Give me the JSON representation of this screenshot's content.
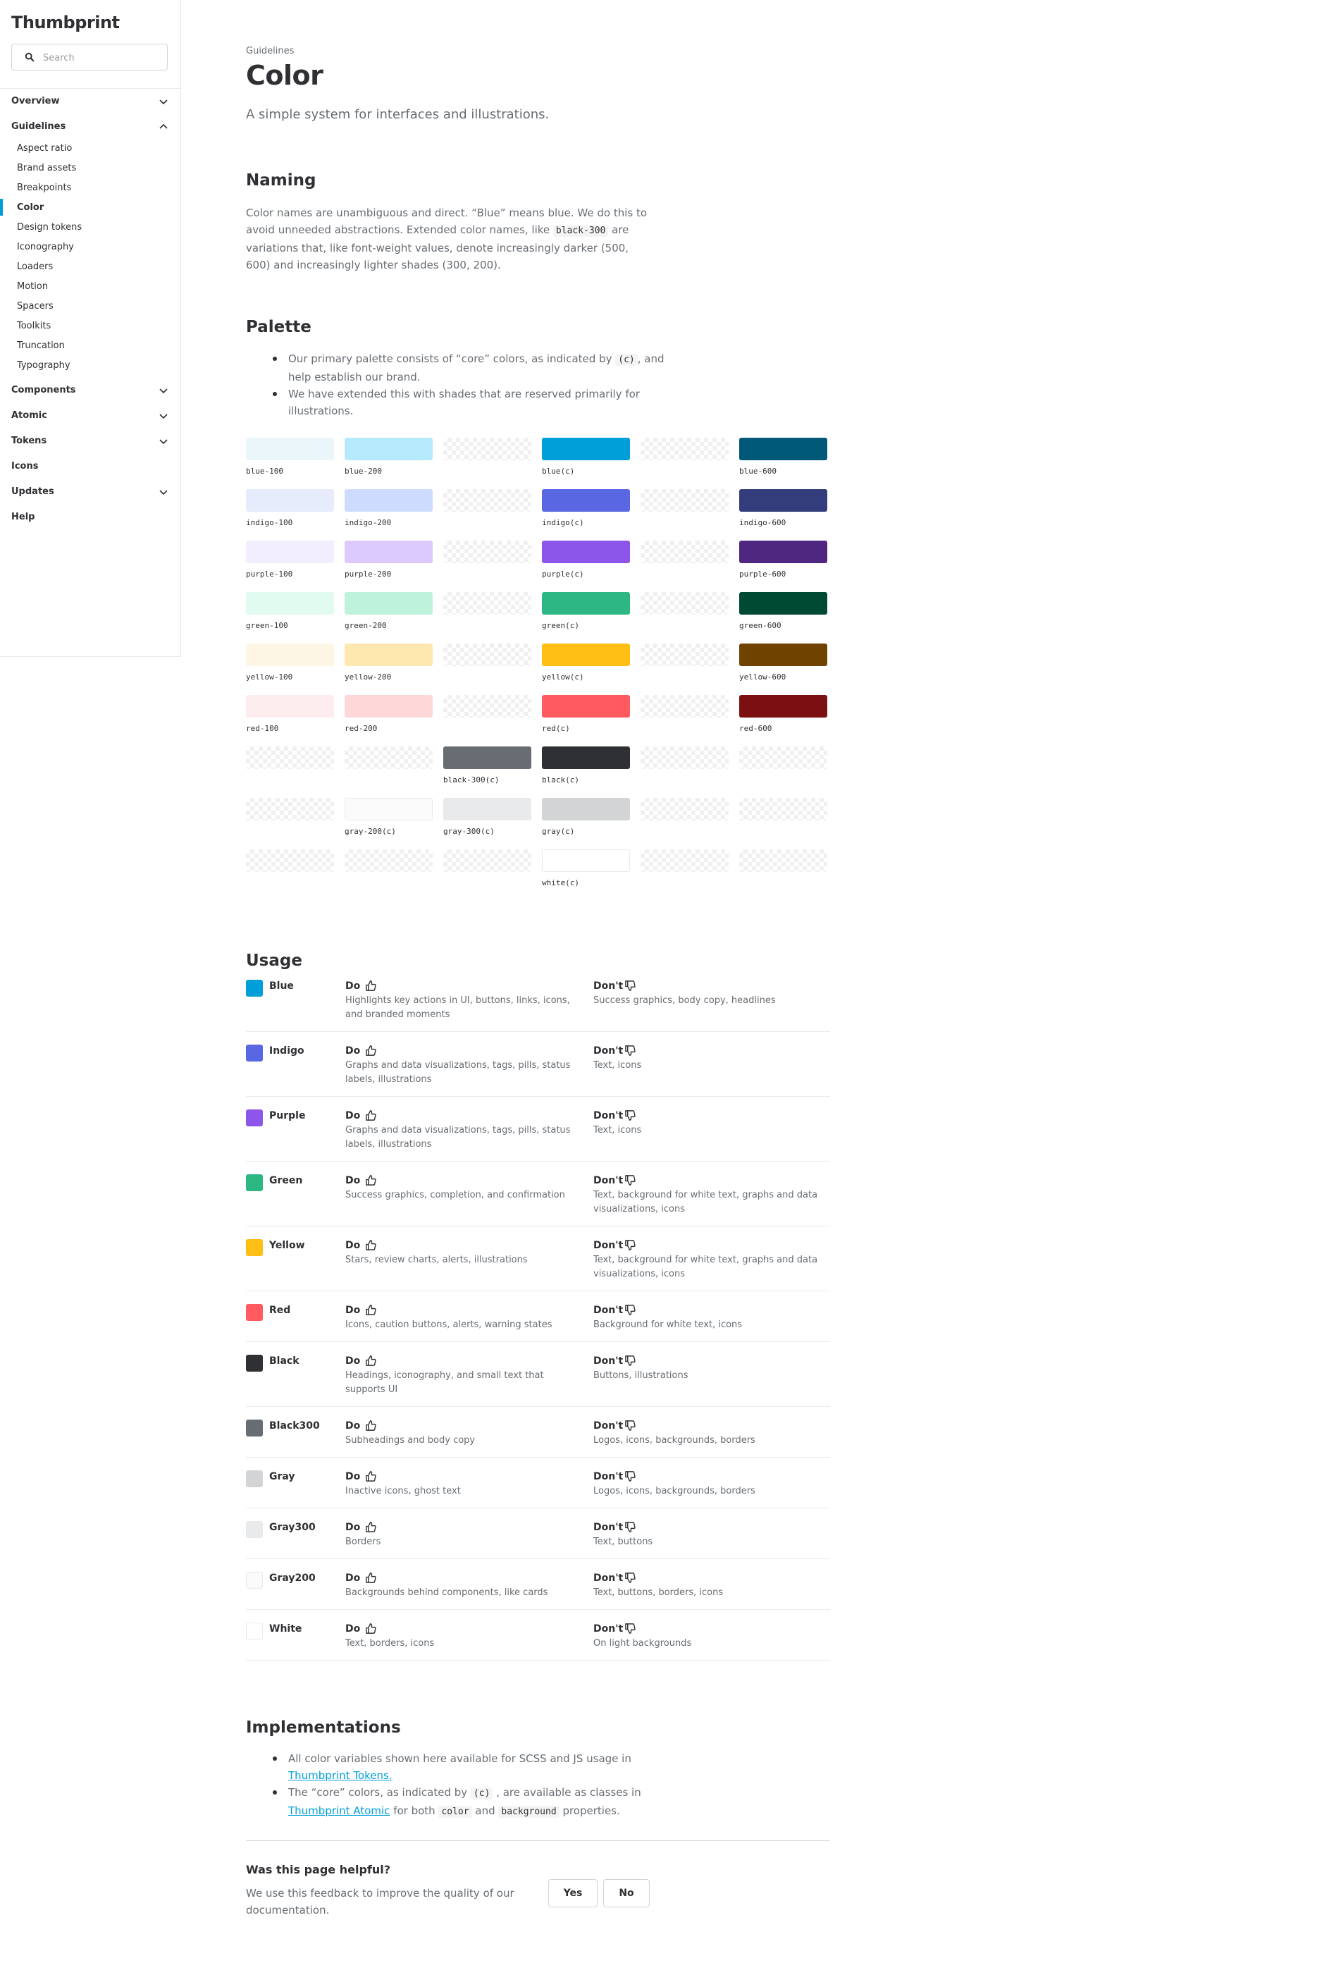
{
  "sidebar": {
    "logo": "Thumbprint",
    "search_placeholder": "Search",
    "sections": [
      {
        "label": "Overview",
        "expanded": false
      },
      {
        "label": "Guidelines",
        "expanded": true
      },
      {
        "label": "Components",
        "expanded": false
      },
      {
        "label": "Atomic",
        "expanded": false
      },
      {
        "label": "Tokens",
        "expanded": false
      },
      {
        "label": "Icons"
      },
      {
        "label": "Updates",
        "expanded": false
      },
      {
        "label": "Help"
      }
    ],
    "guideline_items": [
      "Aspect ratio",
      "Brand assets",
      "Breakpoints",
      "Color",
      "Design tokens",
      "Iconography",
      "Loaders",
      "Motion",
      "Spacers",
      "Toolkits",
      "Truncation",
      "Typography"
    ],
    "active_item": "Color"
  },
  "header": {
    "breadcrumb": "Guidelines",
    "title": "Color",
    "subtitle": "A simple system for interfaces and illustrations."
  },
  "naming": {
    "heading": "Naming",
    "text_1": "Color names are unambiguous and direct. “Blue” means blue. We do this to avoid unneeded abstractions. Extended color names, like",
    "code": "black-300",
    "text_2": "are variations that, like font-weight values, denote increasingly darker (500, 600) and increasingly lighter shades (300, 200)."
  },
  "palette": {
    "heading": "Palette",
    "bullet_1_a": "Our primary palette consists of “core” colors, as indicated by",
    "bullet_1_code": "(c)",
    "bullet_1_b": ", and help establish our brand.",
    "bullet_2": "We have extended this with shades that are reserved primarily for illustrations.",
    "rows": [
      [
        {
          "name": "blue-100",
          "color": "#eaf6fa"
        },
        {
          "name": "blue-200",
          "color": "#b5eafc"
        },
        null,
        {
          "name": "blue(c)",
          "color": "#009fd9"
        },
        null,
        {
          "name": "blue-600",
          "color": "#005879"
        }
      ],
      [
        {
          "name": "indigo-100",
          "color": "#e6ecfb"
        },
        {
          "name": "indigo-200",
          "color": "#cddcfe"
        },
        null,
        {
          "name": "indigo(c)",
          "color": "#5968e2"
        },
        null,
        {
          "name": "indigo-600",
          "color": "#343d7b"
        }
      ],
      [
        {
          "name": "purple-100",
          "color": "#f3eefe"
        },
        {
          "name": "purple-200",
          "color": "#ddcafd"
        },
        null,
        {
          "name": "purple(c)",
          "color": "#8d56eb"
        },
        null,
        {
          "name": "purple-600",
          "color": "#4f2680"
        }
      ],
      [
        {
          "name": "green-100",
          "color": "#e1fbf1"
        },
        {
          "name": "green-200",
          "color": "#bff2da"
        },
        null,
        {
          "name": "green(c)",
          "color": "#2db783"
        },
        null,
        {
          "name": "green-600",
          "color": "#004a34"
        }
      ],
      [
        {
          "name": "yellow-100",
          "color": "#fef6e5"
        },
        {
          "name": "yellow-200",
          "color": "#ffe8af"
        },
        null,
        {
          "name": "yellow(c)",
          "color": "#febe14"
        },
        null,
        {
          "name": "yellow-600",
          "color": "#704200"
        }
      ],
      [
        {
          "name": "red-100",
          "color": "#fdedee"
        },
        {
          "name": "red-200",
          "color": "#fed7d9"
        },
        null,
        {
          "name": "red(c)",
          "color": "#ff5a5f"
        },
        null,
        {
          "name": "red-600",
          "color": "#7c0f11"
        }
      ],
      [
        null,
        null,
        {
          "name": "black-300(c)",
          "color": "#676d73"
        },
        {
          "name": "black(c)",
          "color": "#2f3033"
        },
        null,
        null
      ],
      [
        null,
        {
          "name": "gray-200(c)",
          "color": "#fafafa"
        },
        {
          "name": "gray-300(c)",
          "color": "#e9eaeb"
        },
        {
          "name": "gray(c)",
          "color": "#d3d4d5"
        },
        null,
        null
      ],
      [
        null,
        null,
        null,
        {
          "name": "white(c)",
          "color": "#ffffff"
        },
        null,
        null
      ]
    ]
  },
  "usage": {
    "heading": "Usage",
    "do_label": "Do",
    "dont_label": "Don't",
    "rows": [
      {
        "name": "Blue",
        "color": "#009fd9",
        "do": "Highlights key actions in UI, buttons, links, icons, and branded moments",
        "dont": "Success graphics, body copy, headlines"
      },
      {
        "name": "Indigo",
        "color": "#5968e2",
        "do": "Graphs and data visualizations, tags, pills, status labels, illustrations",
        "dont": "Text, icons"
      },
      {
        "name": "Purple",
        "color": "#8d56eb",
        "do": "Graphs and data visualizations, tags, pills, status labels, illustrations",
        "dont": "Text, icons"
      },
      {
        "name": "Green",
        "color": "#2db783",
        "do": "Success graphics, completion, and confirmation",
        "dont": "Text, background for white text, graphs and data visualizations, icons"
      },
      {
        "name": "Yellow",
        "color": "#febe14",
        "do": "Stars, review charts, alerts, illustrations",
        "dont": "Text, background for white text, graphs and data visualizations, icons"
      },
      {
        "name": "Red",
        "color": "#ff5a5f",
        "do": "Icons, caution buttons, alerts, warning states",
        "dont": "Background for white text, icons"
      },
      {
        "name": "Black",
        "color": "#2f3033",
        "do": "Headings, iconography, and small text that supports UI",
        "dont": "Buttons, illustrations"
      },
      {
        "name": "Black300",
        "color": "#676d73",
        "do": "Subheadings and body copy",
        "dont": "Logos, icons, backgrounds, borders"
      },
      {
        "name": "Gray",
        "color": "#d3d4d5",
        "do": "Inactive icons, ghost text",
        "dont": "Logos, icons, backgrounds, borders"
      },
      {
        "name": "Gray300",
        "color": "#e9eaeb",
        "do": "Borders",
        "dont": "Text, buttons"
      },
      {
        "name": "Gray200",
        "color": "#fafafa",
        "do": "Backgrounds behind components, like cards",
        "dont": "Text, buttons, borders, icons"
      },
      {
        "name": "White",
        "color": "#ffffff",
        "do": "Text, borders, icons",
        "dont": "On light backgrounds"
      }
    ]
  },
  "implementations": {
    "heading": "Implementations",
    "b1_text": "All color variables shown here available for SCSS and JS usage in",
    "b1_link": "Thumbprint Tokens.",
    "b2_a": "The “core” colors, as indicated by",
    "b2_code": "(c)",
    "b2_b": ", are available as classes in",
    "b2_link": "Thumbprint Atomic",
    "b2_c": "for both",
    "b2_code2": "color",
    "b2_d": "and",
    "b2_code3": "background",
    "b2_e": "properties."
  },
  "feedback": {
    "title": "Was this page helpful?",
    "text": "We use this feedback to improve the quality of our documentation.",
    "yes": "Yes",
    "no": "No"
  },
  "colors": {
    "accent": "#009fd9",
    "text": "#2f3033",
    "muted": "#676d73",
    "border": "#e9eaeb"
  }
}
